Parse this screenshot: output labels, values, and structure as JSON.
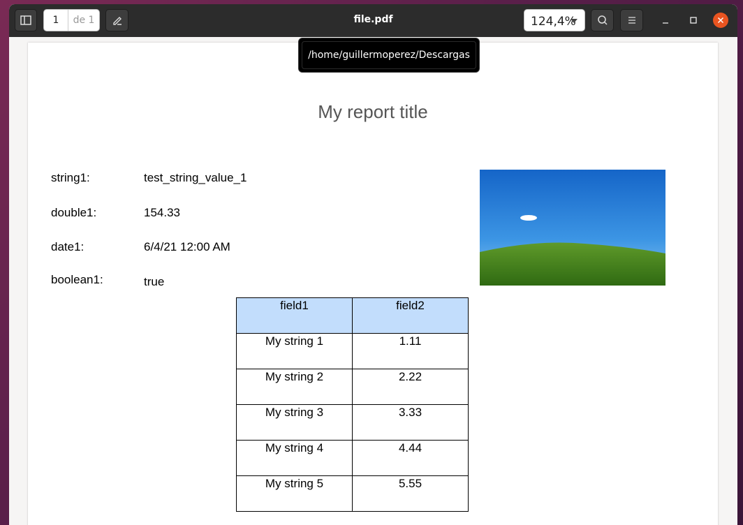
{
  "window": {
    "title": "file.pdf"
  },
  "toolbar": {
    "page_current": "1",
    "page_total": "de 1",
    "zoom": "124,4%"
  },
  "tooltip": {
    "path": "/home/guillermoperez/Descargas"
  },
  "report": {
    "title": "My report title",
    "fields": [
      {
        "label": "string1:",
        "value": "test_string_value_1"
      },
      {
        "label": "double1:",
        "value": "154.33"
      },
      {
        "label": "date1:",
        "value": "6/4/21 12:00 AM"
      },
      {
        "label": "boolean1:",
        "value": "true"
      }
    ],
    "table": {
      "headers": [
        "field1",
        "field2"
      ],
      "rows": [
        [
          "My string 1",
          "1.11"
        ],
        [
          "My string 2",
          "2.22"
        ],
        [
          "My string 3",
          "3.33"
        ],
        [
          "My string 4",
          "4.44"
        ],
        [
          "My string 5",
          "5.55"
        ]
      ]
    }
  },
  "colors": {
    "headerbar": "#2c2c2c",
    "close": "#e95420",
    "table_header": "#c2ddfc"
  }
}
